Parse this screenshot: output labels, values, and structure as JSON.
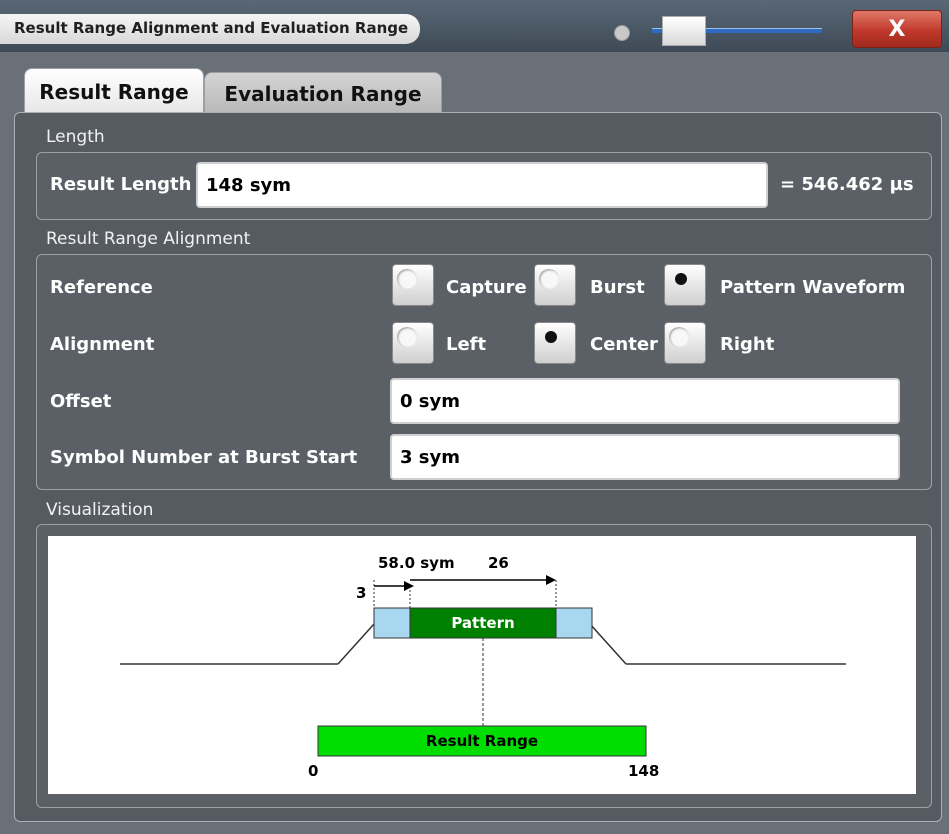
{
  "window": {
    "title": "Result Range Alignment and Evaluation Range",
    "close_label": "X"
  },
  "tabs": [
    {
      "label": "Result Range",
      "active": true
    },
    {
      "label": "Evaluation Range",
      "active": false
    }
  ],
  "length_section": {
    "title": "Length",
    "result_length_label": "Result Length",
    "result_length_value": "148 sym",
    "result_length_time": "= 546.462 µs"
  },
  "alignment_section": {
    "title": "Result Range Alignment",
    "reference_label": "Reference",
    "reference_options": [
      {
        "label": "Capture",
        "selected": false
      },
      {
        "label": "Burst",
        "selected": false
      },
      {
        "label": "Pattern Waveform",
        "selected": true
      }
    ],
    "alignment_label": "Alignment",
    "alignment_options": [
      {
        "label": "Left",
        "selected": false
      },
      {
        "label": "Center",
        "selected": true
      },
      {
        "label": "Right",
        "selected": false
      }
    ],
    "offset_label": "Offset",
    "offset_value": "0 sym",
    "burst_start_label": "Symbol Number at Burst Start",
    "burst_start_value": "3 sym"
  },
  "visualization": {
    "title": "Visualization",
    "offset_text": "58.0 sym",
    "pattern_length_text": "26",
    "burst_start_text": "3",
    "pattern_label": "Pattern",
    "result_range_label": "Result Range",
    "range_start": "0",
    "range_end": "148",
    "colors": {
      "burst_edge": "#a8d8f0",
      "pattern": "#008000",
      "result_range": "#00dd00"
    }
  }
}
